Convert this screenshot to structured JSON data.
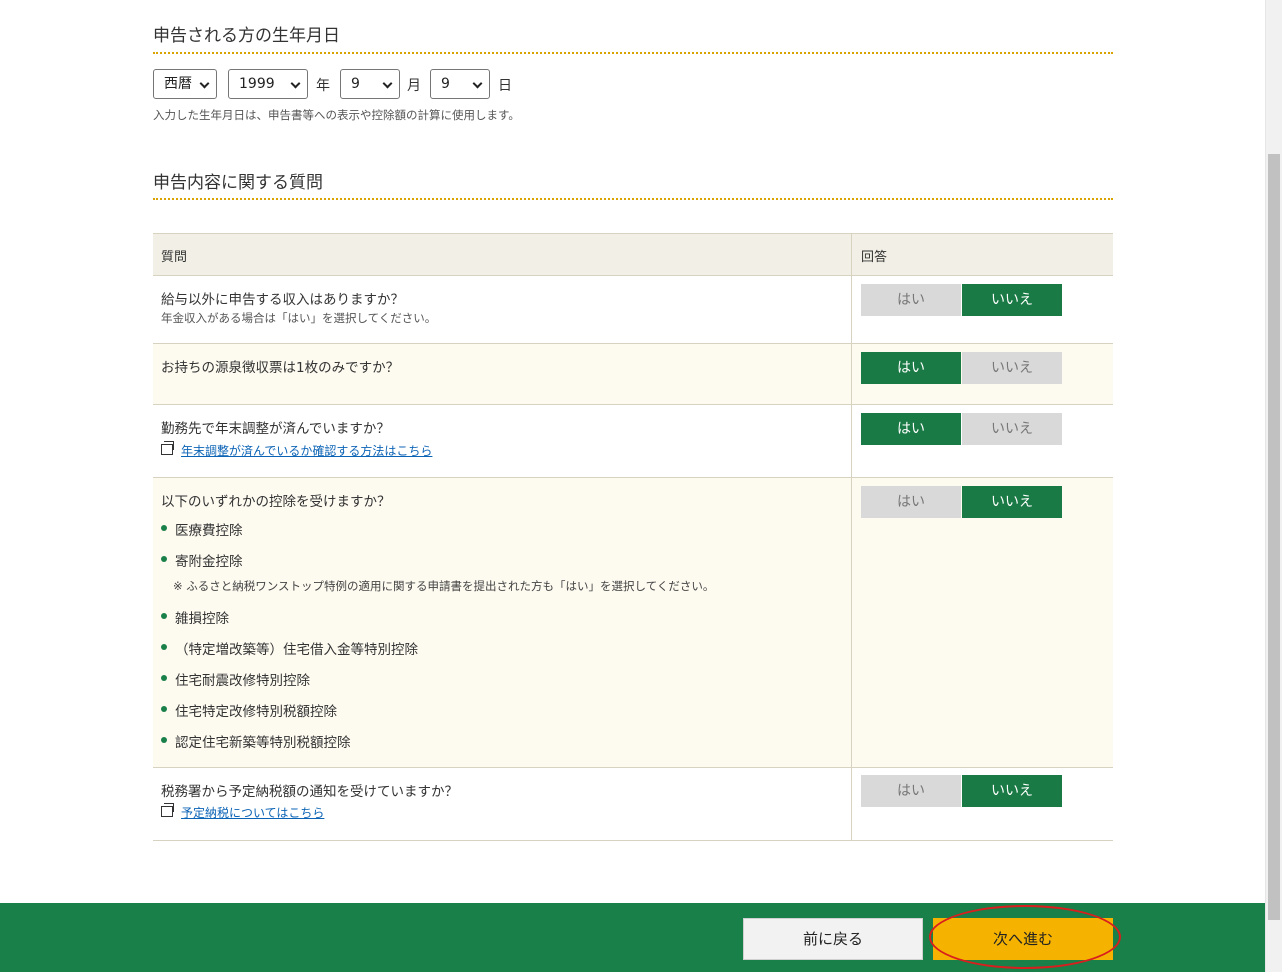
{
  "birthdate_section": {
    "title": "申告される方の生年月日",
    "era": {
      "value": "西暦"
    },
    "year": {
      "value": "1999",
      "unit": "年"
    },
    "month": {
      "value": "9",
      "unit": "月"
    },
    "day": {
      "value": "9",
      "unit": "日"
    },
    "hint": "入力した生年月日は、申告書等への表示や控除額の計算に使用します。"
  },
  "questions_section": {
    "title": "申告内容に関する質問",
    "header": {
      "question": "質問",
      "answer": "回答"
    },
    "yes_label": "はい",
    "no_label": "いいえ",
    "rows": [
      {
        "text": "給与以外に申告する収入はありますか？",
        "sub": "年金収入がある場合は「はい」を選択してください。",
        "answer": "いいえ"
      },
      {
        "text": "お持ちの源泉徴収票は1枚のみですか？",
        "answer": "はい"
      },
      {
        "text": "勤務先で年末調整が済んでいますか？",
        "link": "年末調整が済んでいるか確認する方法はこちら",
        "answer": "はい"
      },
      {
        "text": "以下のいずれかの控除を受けますか？",
        "bullets": [
          "医療費控除",
          "寄附金控除",
          "雑損控除",
          "（特定増改築等）住宅借入金等特別控除",
          "住宅耐震改修特別控除",
          "住宅特定改修特別税額控除",
          "認定住宅新築等特別税額控除"
        ],
        "note": "※ ふるさと納税ワンストップ特例の適用に関する申請書を提出された方も「はい」を選択してください。",
        "answer": "いいえ"
      },
      {
        "text": "税務署から予定納税額の通知を受けていますか？",
        "link": "予定納税についてはこちら",
        "answer": "いいえ"
      }
    ]
  },
  "footer": {
    "back_label": "前に戻る",
    "next_label": "次へ進む"
  },
  "colors": {
    "accent_green": "#1a7a45",
    "footer_green": "#1a8049",
    "next_button": "#f5b300",
    "highlight_ring": "#d81e1e"
  }
}
